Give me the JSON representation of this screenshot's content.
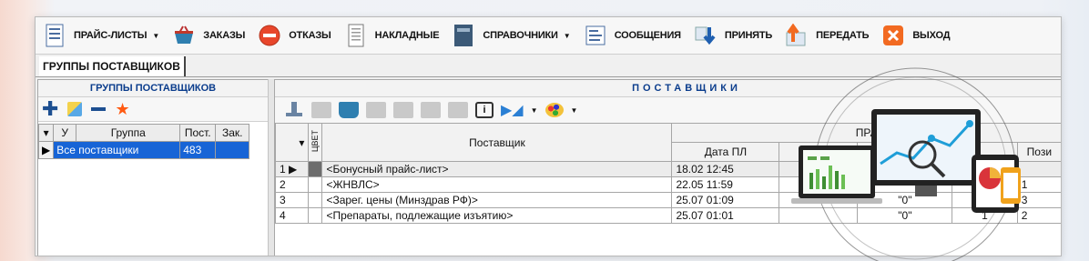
{
  "toolbar": {
    "items": [
      {
        "label": "ПРАЙС-ЛИСТЫ",
        "dropdown": true,
        "icon": "document-list-icon"
      },
      {
        "label": "ЗАКАЗЫ",
        "dropdown": false,
        "icon": "basket-icon"
      },
      {
        "label": "ОТКАЗЫ",
        "dropdown": false,
        "icon": "stop-icon"
      },
      {
        "label": "НАКЛАДНЫЕ",
        "dropdown": false,
        "icon": "invoice-icon"
      },
      {
        "label": "СПРАВОЧНИКИ",
        "dropdown": true,
        "icon": "book-icon"
      },
      {
        "label": "СООБЩЕНИЯ",
        "dropdown": false,
        "icon": "message-icon"
      },
      {
        "label": "ПРИНЯТЬ",
        "dropdown": false,
        "icon": "download-icon"
      },
      {
        "label": "ПЕРЕДАТЬ",
        "dropdown": false,
        "icon": "upload-icon"
      },
      {
        "label": "ВЫХОД",
        "dropdown": false,
        "icon": "exit-icon"
      }
    ]
  },
  "tab": {
    "label": "ГРУППЫ ПОСТАВЩИКОВ"
  },
  "left": {
    "title": "ГРУППЫ ПОСТАВЩИКОВ",
    "columns": [
      "У",
      "Группа",
      "Пост.",
      "Зак."
    ],
    "rows": [
      {
        "group": "Все поставщики",
        "count": "483",
        "orders": ""
      }
    ]
  },
  "right": {
    "title": "ПОСТАВЩИКИ",
    "col_color": "ЦВЕТ",
    "col_supplier": "Поставщик",
    "col_group_partial": "ПРА",
    "col_date": "Дата ПЛ",
    "col_pos_partial": "Пози",
    "rows": [
      {
        "n": "1",
        "name": "<Бонусный прайс-лист>",
        "date": "18.02  12:45",
        "q": "",
        "a": "",
        "b": ""
      },
      {
        "n": "2",
        "name": "<ЖНВЛС>",
        "date": "22.05  11:59",
        "q": "",
        "a": "",
        "b": "1"
      },
      {
        "n": "3",
        "name": "<Зарег. цены (Минздрав РФ)>",
        "date": "25.07  01:09",
        "q": "\"0\"",
        "a": "1",
        "b": "3"
      },
      {
        "n": "4",
        "name": "<Препараты, подлежащие изъятию>",
        "date": "25.07  01:01",
        "q": "\"0\"",
        "a": "1",
        "b": "2"
      }
    ]
  },
  "colors": {
    "accent": "#1764d6",
    "title_blue": "#0a3c8c"
  }
}
